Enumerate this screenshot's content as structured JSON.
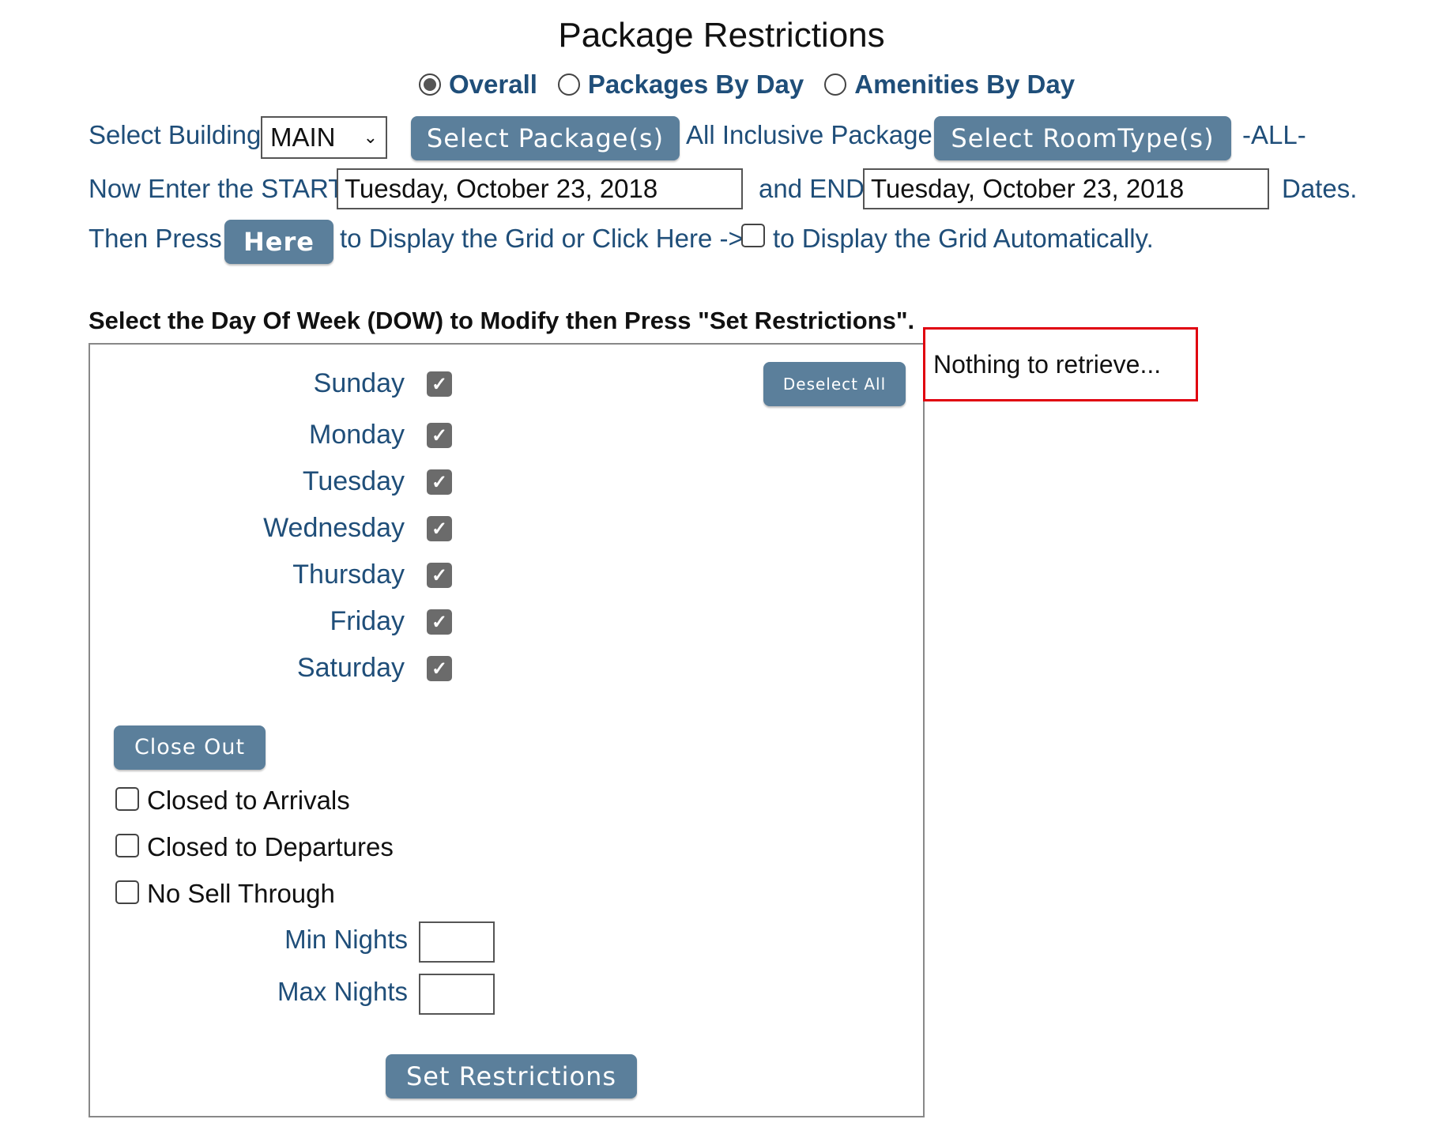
{
  "page": {
    "title": "Package Restrictions"
  },
  "view_options": [
    {
      "label": "Overall",
      "selected": true
    },
    {
      "label": "Packages By Day",
      "selected": false
    },
    {
      "label": "Amenities By Day",
      "selected": false
    }
  ],
  "building": {
    "label": "Select Building",
    "value": "MAIN"
  },
  "packages": {
    "button_label": "Select Package(s)",
    "selected_text": "All Inclusive Package"
  },
  "room_types": {
    "button_label": "Select RoomType(s)",
    "selected_text": "-ALL-"
  },
  "dates": {
    "start_label": "Now Enter the START",
    "start_value": "Tuesday, October 23, 2018",
    "end_label": "and END",
    "end_value": "Tuesday, October 23, 2018",
    "suffix": "Dates."
  },
  "display": {
    "prefix": "Then Press",
    "here_button": "Here",
    "middle": "to Display the Grid or Click Here ->",
    "auto_label": "to Display the Grid Automatically.",
    "auto_checked": false
  },
  "dow": {
    "instruction": "Select the Day Of Week (DOW) to Modify then Press \"Set Restrictions\".",
    "deselect_all_label": "Deselect All",
    "days": [
      {
        "label": "Sunday",
        "checked": true
      },
      {
        "label": "Monday",
        "checked": true
      },
      {
        "label": "Tuesday",
        "checked": true
      },
      {
        "label": "Wednesday",
        "checked": true
      },
      {
        "label": "Thursday",
        "checked": true
      },
      {
        "label": "Friday",
        "checked": true
      },
      {
        "label": "Saturday",
        "checked": true
      }
    ]
  },
  "restrictions": {
    "close_out_label": "Close Out",
    "closed_to_arrivals": "Closed to Arrivals",
    "closed_to_departures": "Closed to Departures",
    "no_sell_through": "No Sell Through",
    "min_nights_label": "Min Nights",
    "min_nights_value": "",
    "max_nights_label": "Max Nights",
    "max_nights_value": "",
    "set_restrictions_label": "Set Restrictions"
  },
  "message": {
    "text": "Nothing to retrieve...",
    "border_color": "#e0000f"
  },
  "colors": {
    "label_blue": "#1f4e79",
    "button_bg": "#5b7f9b"
  }
}
